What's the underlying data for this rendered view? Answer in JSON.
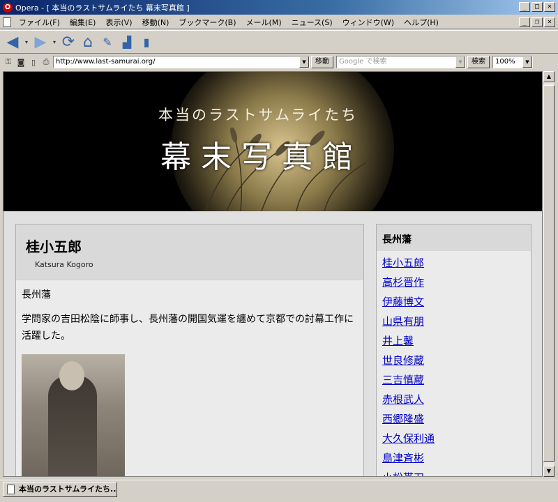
{
  "window": {
    "title": "Opera - [ 本当のラストサムライたち 幕末写真館 ]",
    "app_icon": "O",
    "controls": [
      "_",
      "□",
      "×"
    ],
    "mdi_controls": [
      "_",
      "❐",
      "×"
    ]
  },
  "menu": [
    "ファイル(F)",
    "編集(E)",
    "表示(V)",
    "移動(N)",
    "ブックマーク(B)",
    "メール(M)",
    "ニュース(S)",
    "ウィンドウ(W)",
    "ヘルプ(H)"
  ],
  "toolbar": {
    "back_icon": "back-arrow-icon",
    "forward_icon": "forward-arrow-icon",
    "reload_icon": "reload-icon",
    "home_icon": "home-icon"
  },
  "address": {
    "url": "http://www.last-samurai.org/",
    "go_label": "移動",
    "search_placeholder": "Google で検索",
    "search_label": "検索",
    "zoom": "100%"
  },
  "banner": {
    "subtitle": "本当のラストサムライたち",
    "title": "幕末写真館"
  },
  "main": {
    "name": "桂小五郎",
    "romaji": "Katsura Kogoro",
    "clan": "長州藩",
    "description": "学問家の吉田松陰に師事し、長州藩の開国気運を纏めて京都での討幕工作に活躍した。"
  },
  "sidebar": {
    "heading": "長州藩",
    "links": [
      "桂小五郎",
      "高杉晋作",
      "伊藤博文",
      "山県有朋",
      "井上馨",
      "世良修蔵",
      "三吉慎蔵",
      "赤根武人",
      "西郷隆盛",
      "大久保利通",
      "島津斉彬",
      "小松帯刀"
    ]
  },
  "status": {
    "tab_label": "本当のラストサムライたち..."
  }
}
